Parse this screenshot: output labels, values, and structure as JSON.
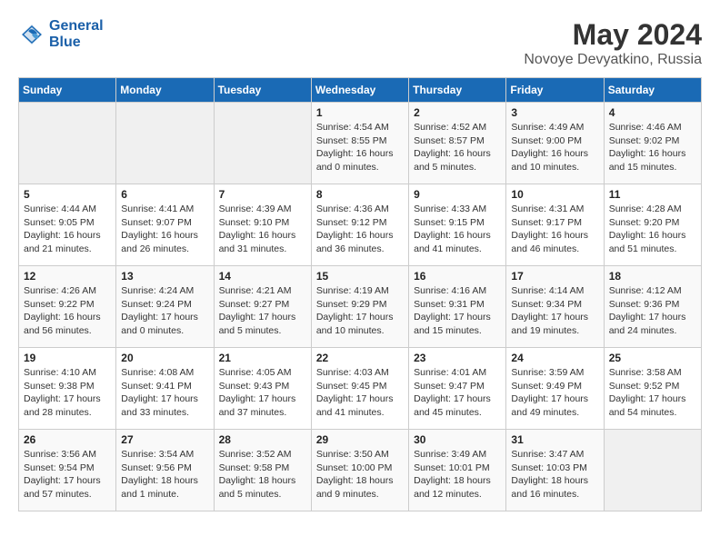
{
  "logo": {
    "line1": "General",
    "line2": "Blue"
  },
  "title": {
    "month_year": "May 2024",
    "location": "Novoye Devyatkino, Russia"
  },
  "headers": [
    "Sunday",
    "Monday",
    "Tuesday",
    "Wednesday",
    "Thursday",
    "Friday",
    "Saturday"
  ],
  "weeks": [
    [
      {
        "day": "",
        "info": ""
      },
      {
        "day": "",
        "info": ""
      },
      {
        "day": "",
        "info": ""
      },
      {
        "day": "1",
        "info": "Sunrise: 4:54 AM\nSunset: 8:55 PM\nDaylight: 16 hours\nand 0 minutes."
      },
      {
        "day": "2",
        "info": "Sunrise: 4:52 AM\nSunset: 8:57 PM\nDaylight: 16 hours\nand 5 minutes."
      },
      {
        "day": "3",
        "info": "Sunrise: 4:49 AM\nSunset: 9:00 PM\nDaylight: 16 hours\nand 10 minutes."
      },
      {
        "day": "4",
        "info": "Sunrise: 4:46 AM\nSunset: 9:02 PM\nDaylight: 16 hours\nand 15 minutes."
      }
    ],
    [
      {
        "day": "5",
        "info": "Sunrise: 4:44 AM\nSunset: 9:05 PM\nDaylight: 16 hours\nand 21 minutes."
      },
      {
        "day": "6",
        "info": "Sunrise: 4:41 AM\nSunset: 9:07 PM\nDaylight: 16 hours\nand 26 minutes."
      },
      {
        "day": "7",
        "info": "Sunrise: 4:39 AM\nSunset: 9:10 PM\nDaylight: 16 hours\nand 31 minutes."
      },
      {
        "day": "8",
        "info": "Sunrise: 4:36 AM\nSunset: 9:12 PM\nDaylight: 16 hours\nand 36 minutes."
      },
      {
        "day": "9",
        "info": "Sunrise: 4:33 AM\nSunset: 9:15 PM\nDaylight: 16 hours\nand 41 minutes."
      },
      {
        "day": "10",
        "info": "Sunrise: 4:31 AM\nSunset: 9:17 PM\nDaylight: 16 hours\nand 46 minutes."
      },
      {
        "day": "11",
        "info": "Sunrise: 4:28 AM\nSunset: 9:20 PM\nDaylight: 16 hours\nand 51 minutes."
      }
    ],
    [
      {
        "day": "12",
        "info": "Sunrise: 4:26 AM\nSunset: 9:22 PM\nDaylight: 16 hours\nand 56 minutes."
      },
      {
        "day": "13",
        "info": "Sunrise: 4:24 AM\nSunset: 9:24 PM\nDaylight: 17 hours\nand 0 minutes."
      },
      {
        "day": "14",
        "info": "Sunrise: 4:21 AM\nSunset: 9:27 PM\nDaylight: 17 hours\nand 5 minutes."
      },
      {
        "day": "15",
        "info": "Sunrise: 4:19 AM\nSunset: 9:29 PM\nDaylight: 17 hours\nand 10 minutes."
      },
      {
        "day": "16",
        "info": "Sunrise: 4:16 AM\nSunset: 9:31 PM\nDaylight: 17 hours\nand 15 minutes."
      },
      {
        "day": "17",
        "info": "Sunrise: 4:14 AM\nSunset: 9:34 PM\nDaylight: 17 hours\nand 19 minutes."
      },
      {
        "day": "18",
        "info": "Sunrise: 4:12 AM\nSunset: 9:36 PM\nDaylight: 17 hours\nand 24 minutes."
      }
    ],
    [
      {
        "day": "19",
        "info": "Sunrise: 4:10 AM\nSunset: 9:38 PM\nDaylight: 17 hours\nand 28 minutes."
      },
      {
        "day": "20",
        "info": "Sunrise: 4:08 AM\nSunset: 9:41 PM\nDaylight: 17 hours\nand 33 minutes."
      },
      {
        "day": "21",
        "info": "Sunrise: 4:05 AM\nSunset: 9:43 PM\nDaylight: 17 hours\nand 37 minutes."
      },
      {
        "day": "22",
        "info": "Sunrise: 4:03 AM\nSunset: 9:45 PM\nDaylight: 17 hours\nand 41 minutes."
      },
      {
        "day": "23",
        "info": "Sunrise: 4:01 AM\nSunset: 9:47 PM\nDaylight: 17 hours\nand 45 minutes."
      },
      {
        "day": "24",
        "info": "Sunrise: 3:59 AM\nSunset: 9:49 PM\nDaylight: 17 hours\nand 49 minutes."
      },
      {
        "day": "25",
        "info": "Sunrise: 3:58 AM\nSunset: 9:52 PM\nDaylight: 17 hours\nand 54 minutes."
      }
    ],
    [
      {
        "day": "26",
        "info": "Sunrise: 3:56 AM\nSunset: 9:54 PM\nDaylight: 17 hours\nand 57 minutes."
      },
      {
        "day": "27",
        "info": "Sunrise: 3:54 AM\nSunset: 9:56 PM\nDaylight: 18 hours\nand 1 minute."
      },
      {
        "day": "28",
        "info": "Sunrise: 3:52 AM\nSunset: 9:58 PM\nDaylight: 18 hours\nand 5 minutes."
      },
      {
        "day": "29",
        "info": "Sunrise: 3:50 AM\nSunset: 10:00 PM\nDaylight: 18 hours\nand 9 minutes."
      },
      {
        "day": "30",
        "info": "Sunrise: 3:49 AM\nSunset: 10:01 PM\nDaylight: 18 hours\nand 12 minutes."
      },
      {
        "day": "31",
        "info": "Sunrise: 3:47 AM\nSunset: 10:03 PM\nDaylight: 18 hours\nand 16 minutes."
      },
      {
        "day": "",
        "info": ""
      }
    ]
  ]
}
